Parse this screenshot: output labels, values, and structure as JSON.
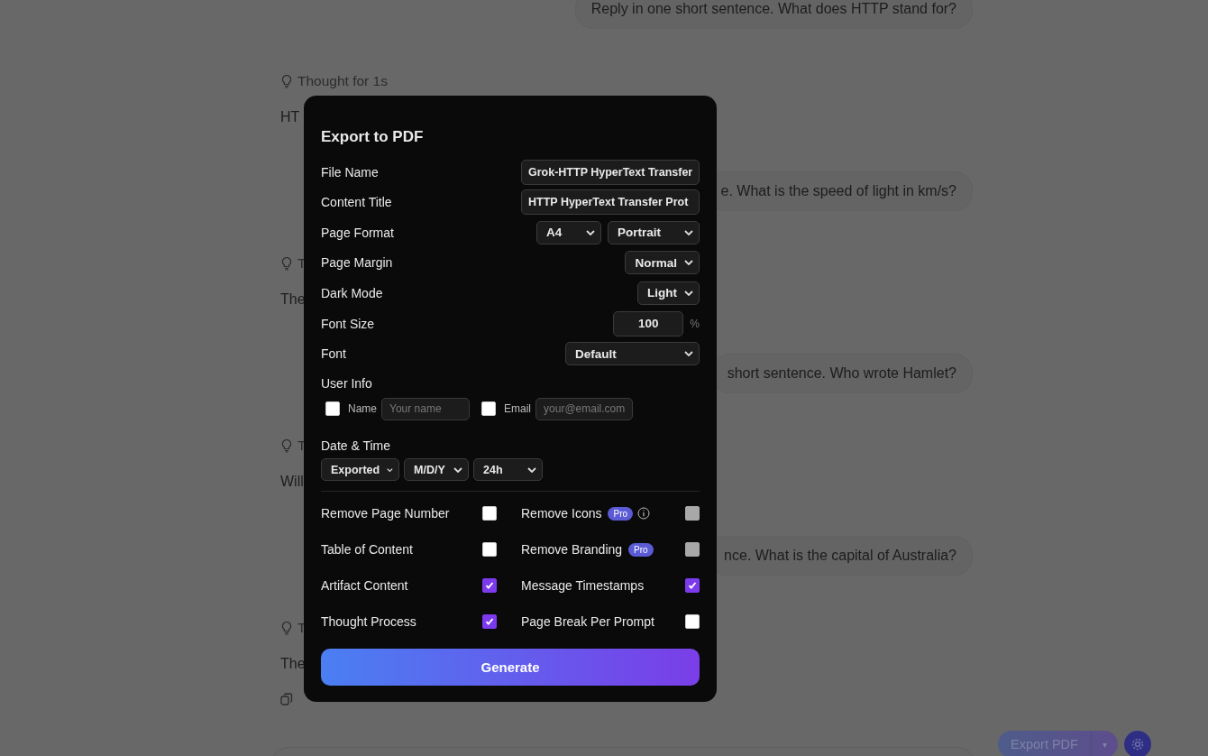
{
  "chat": {
    "turns": [
      {
        "question": "Reply in one short sentence. What does HTTP stand for?",
        "thought": "Thought for 1s",
        "answer": "HT"
      },
      {
        "question": "e. What is the speed of light in km/s?",
        "thought": "T",
        "answer": "The"
      },
      {
        "question": "short sentence. Who wrote Hamlet?",
        "thought": "T",
        "answer": "Will"
      },
      {
        "question": "nce. What is the capital of Australia?",
        "thought": "T",
        "answer": "The"
      }
    ]
  },
  "export_dialog": {
    "title": "Export to PDF",
    "fields": [
      {
        "kind": "text",
        "label": "File Name",
        "value": "Grok-HTTP HyperText Transfer"
      },
      {
        "kind": "text",
        "label": "Content Title",
        "value": "HTTP HyperText Transfer Prot"
      },
      {
        "kind": "select",
        "label": "Page Format",
        "selects": [
          "A4",
          "Portrait"
        ]
      },
      {
        "kind": "select",
        "label": "Page Margin",
        "selects": [
          "Normal"
        ]
      },
      {
        "kind": "select",
        "label": "Dark Mode",
        "selects": [
          "Light"
        ]
      },
      {
        "kind": "number",
        "label": "Font Size",
        "value": "100",
        "unit": "%"
      },
      {
        "kind": "select",
        "label": "Font",
        "selects": [
          "Default"
        ]
      }
    ],
    "user_info": {
      "label": "User Info",
      "entries": [
        {
          "label": "Name",
          "checked": false,
          "placeholder": "Your name"
        },
        {
          "label": "Email",
          "checked": false,
          "placeholder": "your@email.com"
        }
      ]
    },
    "date_time": {
      "label": "Date & Time",
      "selects": [
        "Exported",
        "M/D/Y",
        "24h"
      ]
    },
    "options": [
      {
        "label": "Remove Page Number",
        "checked": false,
        "disabled": false
      },
      {
        "label": "Remove Icons",
        "checked": false,
        "disabled": true,
        "badge": "Pro",
        "info": true
      },
      {
        "label": "Table of Content",
        "checked": false,
        "disabled": false
      },
      {
        "label": "Remove Branding",
        "checked": false,
        "disabled": true,
        "badge": "Pro"
      },
      {
        "label": "Artifact Content",
        "checked": true,
        "disabled": false
      },
      {
        "label": "Message Timestamps",
        "checked": true,
        "disabled": false
      },
      {
        "label": "Thought Process",
        "checked": true,
        "disabled": false
      },
      {
        "label": "Page Break Per Prompt",
        "checked": false,
        "disabled": false
      }
    ],
    "generate_button": "Generate"
  },
  "footer": {
    "export_button": "Export PDF",
    "dropdown_caret": "▾"
  }
}
